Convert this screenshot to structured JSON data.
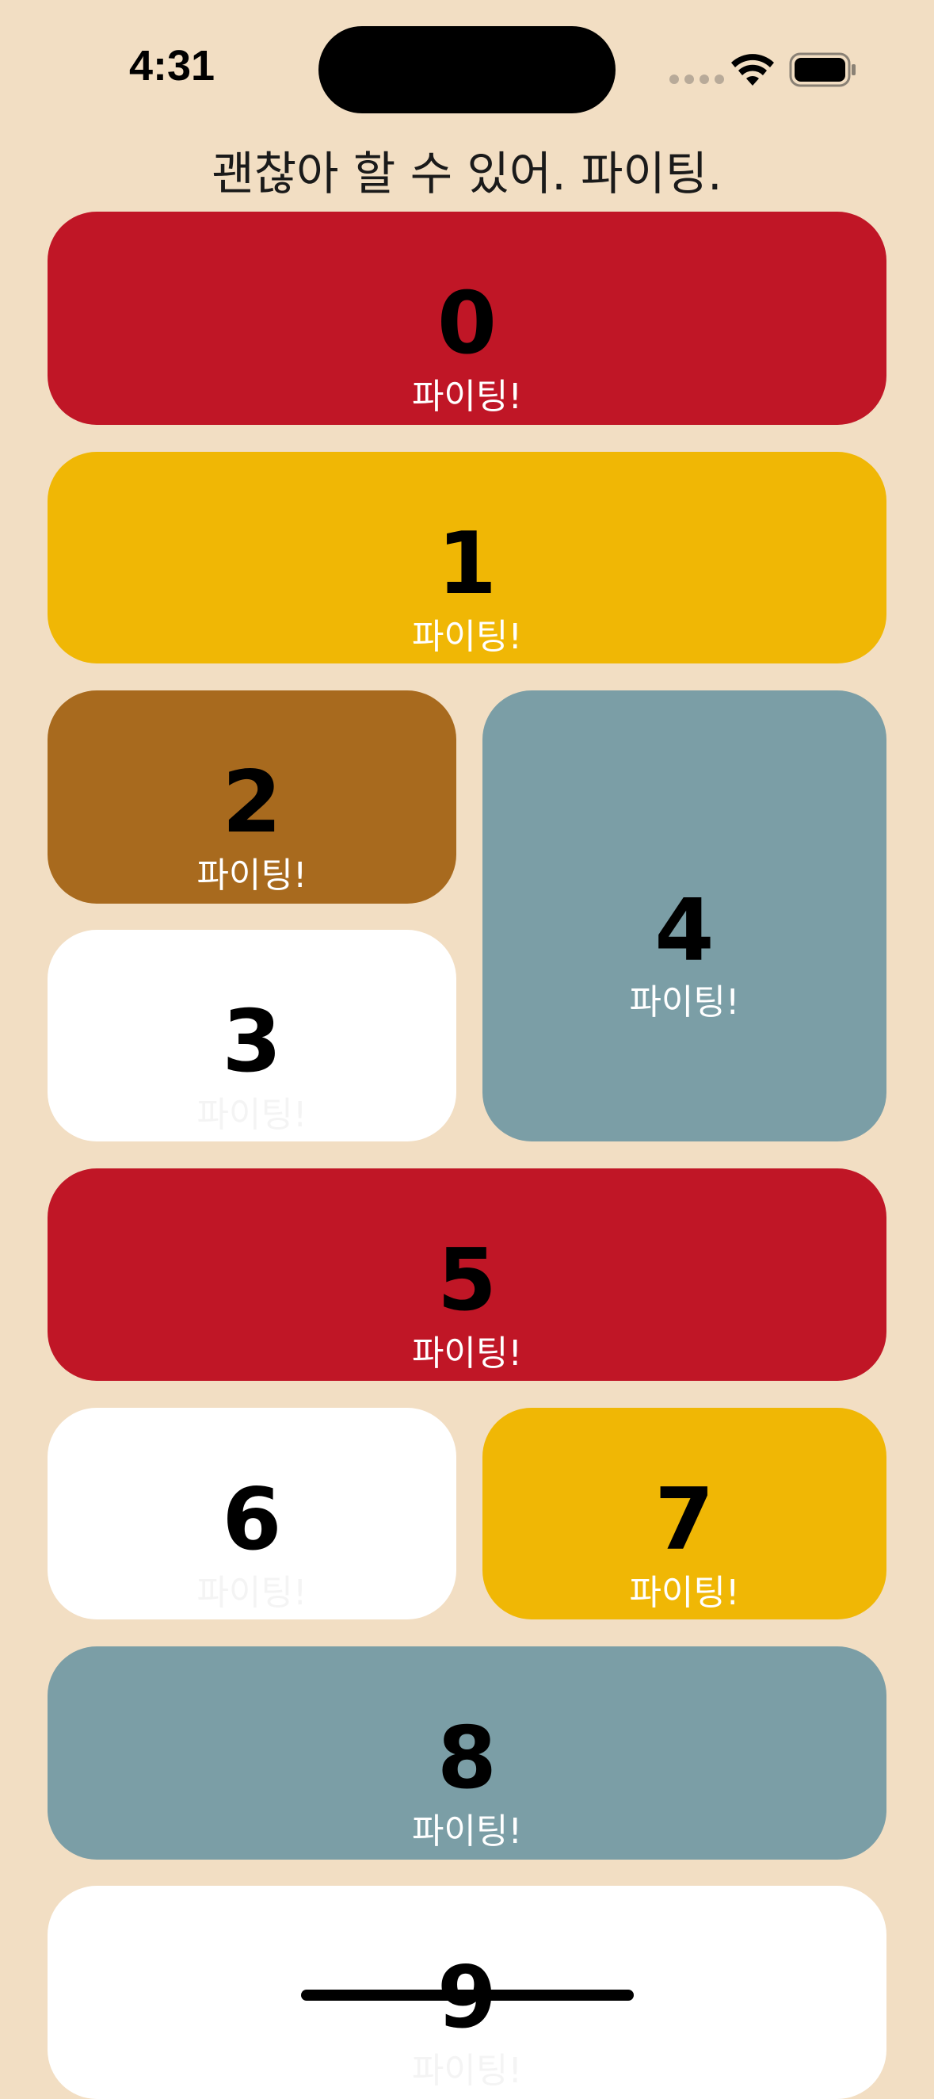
{
  "status_bar": {
    "time": "4:31"
  },
  "header": {
    "title": "괜찮아 할 수 있어. 파이팅."
  },
  "colors": {
    "background": "#f2dec3",
    "red": "#c01626",
    "yellow": "#f0b705",
    "brown": "#a86a1e",
    "gray_blue": "#7b9ea6",
    "white": "#ffffff"
  },
  "cards": [
    {
      "number": "0",
      "cheer": "파이팅!",
      "color": "#c01626"
    },
    {
      "number": "1",
      "cheer": "파이팅!",
      "color": "#f0b705"
    },
    {
      "number": "2",
      "cheer": "파이팅!",
      "color": "#a86a1e"
    },
    {
      "number": "3",
      "cheer": "파이팅!",
      "color": "#ffffff"
    },
    {
      "number": "4",
      "cheer": "파이팅!",
      "color": "#7b9ea6"
    },
    {
      "number": "5",
      "cheer": "파이팅!",
      "color": "#c01626"
    },
    {
      "number": "6",
      "cheer": "파이팅!",
      "color": "#ffffff"
    },
    {
      "number": "7",
      "cheer": "파이팅!",
      "color": "#f0b705"
    },
    {
      "number": "8",
      "cheer": "파이팅!",
      "color": "#7b9ea6"
    },
    {
      "number": "9",
      "cheer": "파이팅!",
      "color": "#ffffff"
    }
  ]
}
